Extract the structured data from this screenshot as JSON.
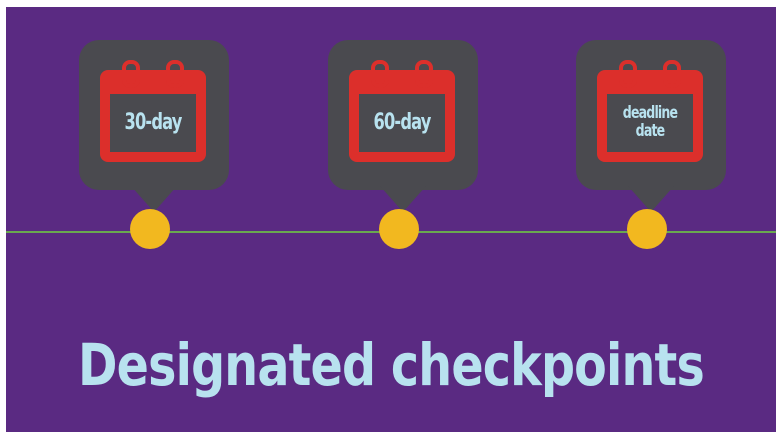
{
  "colors": {
    "background": "#5a2a82",
    "timeline": "#6aa84f",
    "bubble": "#4a4a4f",
    "calendar": "#dc2f2b",
    "dot": "#f2b81f",
    "text": "#b8e2ef"
  },
  "checkpoints": [
    {
      "label": "30-day",
      "icon": "calendar-icon"
    },
    {
      "label": "60-day",
      "icon": "calendar-icon"
    },
    {
      "label": "deadline\ndate",
      "icon": "calendar-icon"
    }
  ],
  "title": "Designated checkpoints"
}
